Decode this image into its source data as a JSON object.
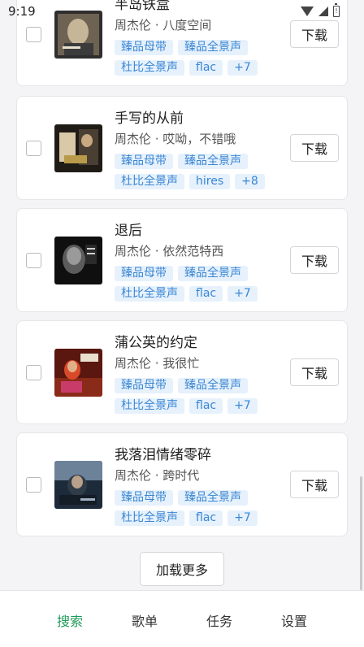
{
  "status_bar": {
    "time": "9:19",
    "battery_glyph": "!"
  },
  "songs": [
    {
      "title": "半岛铁盒",
      "meta": "周杰伦 · 八度空间",
      "tags": [
        "臻品母带",
        "臻品全景声",
        "杜比全景声",
        "flac",
        "+7"
      ],
      "cover_icon": "album-cover-bayeux",
      "cover_colors": [
        "#3b3b3b",
        "#9c8e78"
      ]
    },
    {
      "title": "手写的从前",
      "meta": "周杰伦 · 哎呦，不错哦",
      "tags": [
        "臻品母带",
        "臻品全景声",
        "杜比全景声",
        "hires",
        "+8"
      ],
      "cover_icon": "album-cover-aiyo",
      "cover_colors": [
        "#1f1b16",
        "#d9c9a8"
      ]
    },
    {
      "title": "退后",
      "meta": "周杰伦 · 依然范特西",
      "tags": [
        "臻品母带",
        "臻品全景声",
        "杜比全景声",
        "flac",
        "+7"
      ],
      "cover_icon": "album-cover-still-fantasy",
      "cover_colors": [
        "#111111",
        "#8a8a8a"
      ]
    },
    {
      "title": "蒲公英的约定",
      "meta": "周杰伦 · 我很忙",
      "tags": [
        "臻品母带",
        "臻品全景声",
        "杜比全景声",
        "flac",
        "+7"
      ],
      "cover_icon": "album-cover-on-the-run",
      "cover_colors": [
        "#5a1710",
        "#d94a2a"
      ]
    },
    {
      "title": "我落泪情绪零碎",
      "meta": "周杰伦 · 跨时代",
      "tags": [
        "臻品母带",
        "臻品全景声",
        "杜比全景声",
        "flac",
        "+7"
      ],
      "cover_icon": "album-cover-the-era",
      "cover_colors": [
        "#1c2a3a",
        "#6b8299"
      ]
    }
  ],
  "download_label": "下载",
  "load_more_label": "加载更多",
  "nav": {
    "items": [
      {
        "label": "搜索",
        "active": true
      },
      {
        "label": "歌单",
        "active": false
      },
      {
        "label": "任务",
        "active": false
      },
      {
        "label": "设置",
        "active": false
      }
    ],
    "active_color": "#1f9a5a"
  },
  "colors": {
    "tag_bg": "#e6f1fc",
    "tag_text": "#3a86d4"
  }
}
